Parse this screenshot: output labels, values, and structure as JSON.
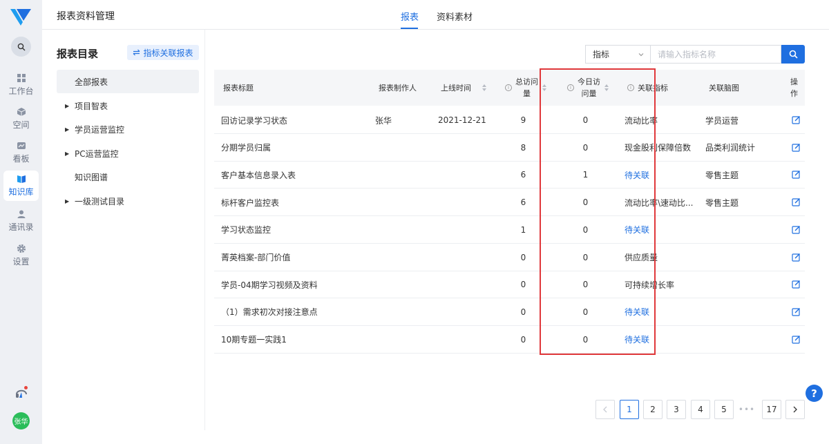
{
  "app": {
    "title": "报表资料管理",
    "tabs": [
      {
        "label": "报表"
      },
      {
        "label": "资料素材"
      }
    ],
    "accent_color": "#1f6fe0",
    "highlight_color": "#e0373a"
  },
  "sidebar": {
    "items": [
      {
        "label": "工作台",
        "icon": "grid-icon"
      },
      {
        "label": "空间",
        "icon": "cube-icon"
      },
      {
        "label": "看板",
        "icon": "dashboard-icon"
      },
      {
        "label": "知识库",
        "icon": "book-icon"
      },
      {
        "label": "通讯录",
        "icon": "person-icon"
      },
      {
        "label": "设置",
        "icon": "gear-icon"
      }
    ],
    "user_avatar": "张华"
  },
  "catalog": {
    "heading": "报表目录",
    "link_button": "指标关联报表",
    "tree": [
      {
        "label": "全部报表",
        "expandable": false
      },
      {
        "label": "项目智表",
        "expandable": true
      },
      {
        "label": "学员运营监控",
        "expandable": true
      },
      {
        "label": "PC运营监控",
        "expandable": true
      },
      {
        "label": "知识图谱",
        "expandable": false
      },
      {
        "label": "一级测试目录",
        "expandable": true
      }
    ]
  },
  "search": {
    "select_value": "指标",
    "placeholder": "请输入指标名称"
  },
  "table": {
    "columns": {
      "title": "报表标题",
      "author": "报表制作人",
      "online_time": "上线时间",
      "total_visits_line1": "总访问",
      "total_visits_line2": "量",
      "today_visits_line1": "今日访",
      "today_visits_line2": "问量",
      "metrics": "关联指标",
      "mindmap": "关联脑图",
      "op_line1": "操",
      "op_line2": "作"
    },
    "rows": [
      {
        "title": "回访记录学习状态",
        "author": "张华",
        "online_time": "2021-12-21",
        "total": "9",
        "today": "0",
        "metrics": "流动比率",
        "metrics_link": false,
        "mindmap": "学员运营"
      },
      {
        "title": "分期学员归属",
        "author": "",
        "online_time": "",
        "total": "8",
        "today": "0",
        "metrics": "现金股利保障倍数",
        "metrics_link": false,
        "mindmap": "品类利润统计"
      },
      {
        "title": "客户基本信息录入表",
        "author": "",
        "online_time": "",
        "total": "6",
        "today": "1",
        "metrics": "待关联",
        "metrics_link": true,
        "mindmap": "零售主题"
      },
      {
        "title": "标杆客户监控表",
        "author": "",
        "online_time": "",
        "total": "6",
        "today": "0",
        "metrics": "流动比率\\速动比...",
        "metrics_link": false,
        "mindmap": "零售主题"
      },
      {
        "title": "学习状态监控",
        "author": "",
        "online_time": "",
        "total": "1",
        "today": "0",
        "metrics": "待关联",
        "metrics_link": true,
        "mindmap": ""
      },
      {
        "title": "菁英档案-部门价值",
        "author": "",
        "online_time": "",
        "total": "0",
        "today": "0",
        "metrics": "供应质量",
        "metrics_link": false,
        "mindmap": ""
      },
      {
        "title": "学员-04期学习视频及资料",
        "author": "",
        "online_time": "",
        "total": "0",
        "today": "0",
        "metrics": "可持续增长率",
        "metrics_link": false,
        "mindmap": ""
      },
      {
        "title": "（1）需求初次对接注意点",
        "author": "",
        "online_time": "",
        "total": "0",
        "today": "0",
        "metrics": "待关联",
        "metrics_link": true,
        "mindmap": ""
      },
      {
        "title": "10期专题一实践1",
        "author": "",
        "online_time": "",
        "total": "0",
        "today": "0",
        "metrics": "待关联",
        "metrics_link": true,
        "mindmap": ""
      }
    ]
  },
  "pagination": {
    "pages": [
      "1",
      "2",
      "3",
      "4",
      "5"
    ],
    "current": "1",
    "ellipsis": "•••",
    "last": "17"
  },
  "help": "?"
}
